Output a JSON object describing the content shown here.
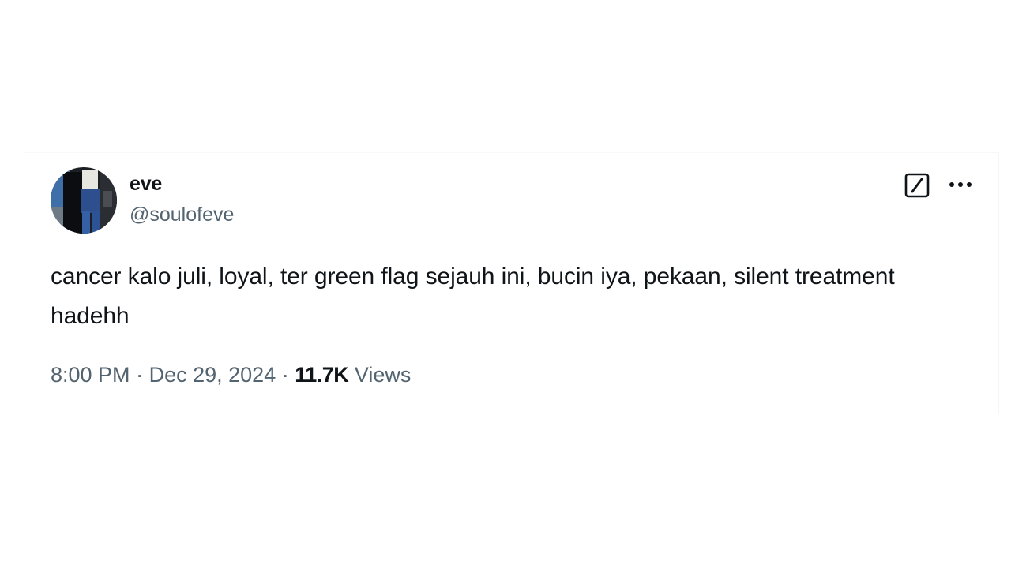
{
  "tweet": {
    "author": {
      "display_name": "eve",
      "handle": "@soulofeve",
      "avatar_icon": "user-avatar-photo"
    },
    "text": "cancer kalo juli, loyal, ter green flag sejauh ini, bucin iya, pekaan, silent treatment hadehh",
    "time": "8:00 PM",
    "separator": "·",
    "date": "Dec 29, 2024",
    "views_count": "11.7K",
    "views_label": "Views",
    "icons": {
      "grok": "grok-icon",
      "more": "more-options-icon"
    }
  }
}
